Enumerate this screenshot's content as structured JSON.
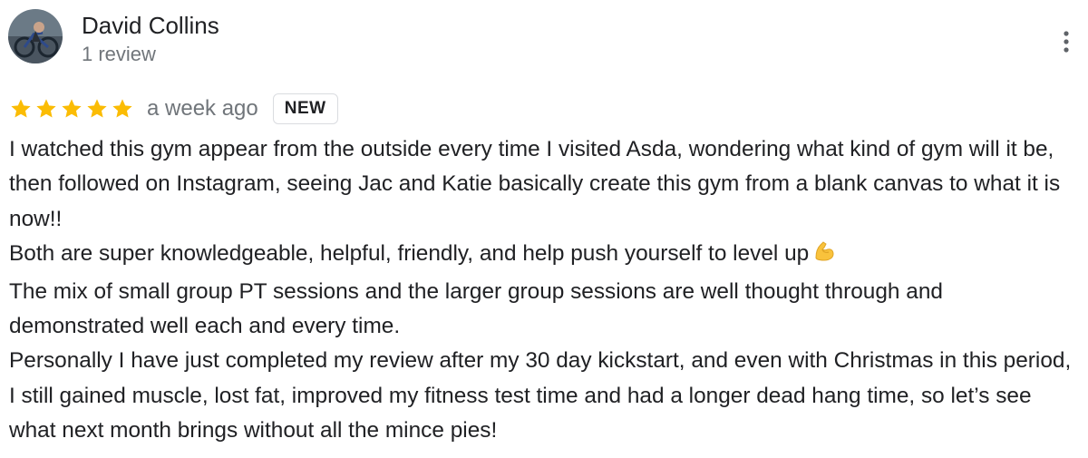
{
  "review": {
    "author": {
      "name": "David Collins",
      "meta": "1 review",
      "avatar_icon": "profile-photo-bicycle"
    },
    "more_icon": "more-vert-icon",
    "rating": {
      "stars": 5,
      "max": 5,
      "star_color": "#fbbc04"
    },
    "date": "a week ago",
    "badge": "NEW",
    "paragraphs": [
      "I watched this gym appear from the outside every time I visited Asda, wondering what kind of gym will it be, then followed on Instagram, seeing Jac and Katie basically create this gym from a blank canvas to what it is now!!",
      "Both are super knowledgeable, helpful, friendly, and help push yourself to level up",
      "The mix of small group PT sessions and the larger group sessions are well thought through and demonstrated well each and every time.",
      "Personally I have just completed my review after my 30 day kickstart, and even with Christmas in this period, I still gained muscle, lost fat, improved my fitness test time and had a longer dead hang time, so let’s see what next month brings without all the mince pies!"
    ],
    "emoji_icon": "flexed-biceps-emoji"
  }
}
